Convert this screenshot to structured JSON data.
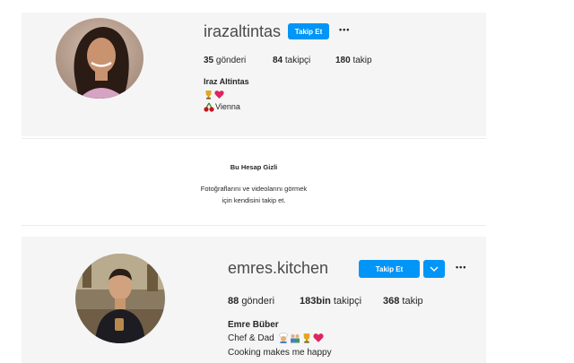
{
  "profile1": {
    "username": "irazaltintas",
    "follow_label": "Takip Et",
    "more_label": "•••",
    "posts": "35",
    "posts_label": "gönderi",
    "followers": "84",
    "followers_label": "takipçi",
    "following": "180",
    "following_label": "takip",
    "full_name": "Iraz Altintas",
    "location": "Vienna",
    "avatar_icon": "profile-photo-woman",
    "bio_icons": [
      "trophy-icon",
      "heart-icon",
      "cherries-icon"
    ]
  },
  "private_notice": {
    "title": "Bu Hesap Gizli",
    "line1": "Fotoğraflarını ve videolarını görmek",
    "line2": "için kendisini takip et."
  },
  "profile2": {
    "username": "emres.kitchen",
    "follow_label": "Takip Et",
    "dropdown_icon": "chevron-down-icon",
    "more_label": "•••",
    "posts": "88",
    "posts_label": "gönderi",
    "followers": "183bin",
    "followers_label": "takipçi",
    "following": "368",
    "following_label": "takip",
    "full_name": "Emre Büber",
    "bio_line1": "Chef & Dad",
    "bio_line2": "Cooking makes me happy",
    "avatar_icon": "profile-photo-man",
    "bio_icons": [
      "chef-icon",
      "family-icon",
      "trophy-icon",
      "heart-icon"
    ]
  },
  "colors": {
    "accent": "#0095f6",
    "heart": "#e0245e",
    "card_bg": "#f5f5f5"
  }
}
